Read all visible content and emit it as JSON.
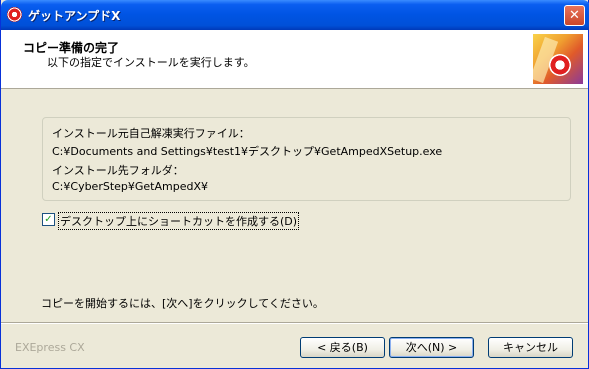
{
  "window": {
    "title": "ゲットアンプドX",
    "close_glyph": "✕"
  },
  "header": {
    "title": "コピー準備の完了",
    "subtitle": "以下の指定でインストールを実行します。"
  },
  "details": {
    "exe_label": "インストール元自己解凍実行ファイル：",
    "exe_path": "C:¥Documents and Settings¥test1¥デスクトップ¥GetAmpedXSetup.exe",
    "dest_label": "インストール先フォルダ：",
    "dest_path": "C:¥CyberStep¥GetAmpedX¥"
  },
  "shortcut": {
    "label": "デスクトップ上にショートカットを作成する(D)",
    "checked": true,
    "check_glyph": "✓"
  },
  "instruction": "コピーを開始するには、[次へ]をクリックしてください。",
  "footer": {
    "brand": "EXEpress CX",
    "back_label": "< 戻る(B)",
    "next_label": "次へ(N) >",
    "cancel_label": "キャンセル"
  }
}
